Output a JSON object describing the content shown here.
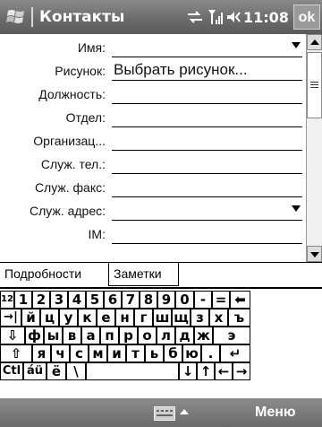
{
  "title_bar": {
    "title": "Контакты",
    "time": "11:08",
    "ok_label": "ok",
    "icons": [
      "windows-logo-icon",
      "connectivity-icon",
      "signal-icon",
      "volume-icon"
    ]
  },
  "fields": [
    {
      "label": "Имя:",
      "value": "",
      "dropdown": true
    },
    {
      "label": "Рисунок:",
      "value": "Выбрать рисунок...",
      "dropdown": false
    },
    {
      "label": "Должность:",
      "value": "",
      "dropdown": false
    },
    {
      "label": "Отдел:",
      "value": "",
      "dropdown": false
    },
    {
      "label": "Организац...",
      "value": "",
      "dropdown": false
    },
    {
      "label": "Служ. тел.:",
      "value": "",
      "dropdown": false
    },
    {
      "label": "Служ. факс:",
      "value": "",
      "dropdown": false
    },
    {
      "label": "Служ. адрес:",
      "value": "",
      "dropdown": true
    },
    {
      "label": "IM:",
      "value": "",
      "dropdown": false
    }
  ],
  "tabs": [
    {
      "label": "Подробности",
      "selected": true
    },
    {
      "label": "Заметки",
      "selected": false
    }
  ],
  "keyboard": {
    "rows": [
      [
        "123",
        "1",
        "2",
        "3",
        "4",
        "5",
        "6",
        "7",
        "8",
        "9",
        "0",
        "-",
        "=",
        "⬅"
      ],
      [
        "→|",
        "й",
        "ц",
        "у",
        "к",
        "е",
        "н",
        "г",
        "ш",
        "щ",
        "з",
        "х",
        "ъ"
      ],
      [
        "⇩",
        "ф",
        "ы",
        "в",
        "а",
        "п",
        "р",
        "о",
        "л",
        "д",
        "ж",
        "э"
      ],
      [
        "⇧",
        "я",
        "ч",
        "с",
        "м",
        "и",
        "т",
        "ь",
        "б",
        "ю",
        ".",
        "↵"
      ],
      [
        "Ctl",
        "áü",
        "ё",
        "\\",
        " ",
        "↓",
        "↑",
        "←",
        "→"
      ]
    ]
  },
  "menu_bar": {
    "menu_label": "Меню",
    "sip_icon": "keyboard-icon"
  },
  "colors": {
    "bar_gray": "#6c6c6c",
    "text": "#111111"
  }
}
